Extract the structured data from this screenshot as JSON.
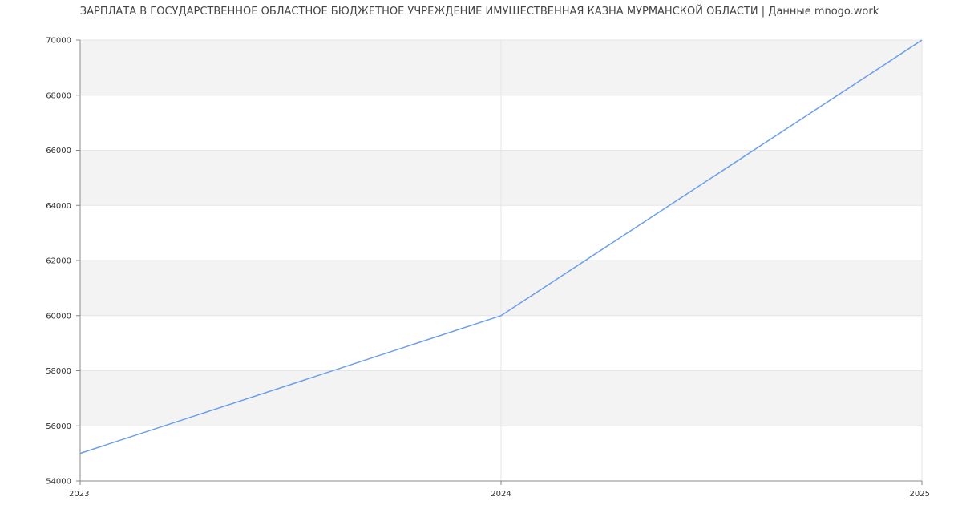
{
  "chart_data": {
    "type": "line",
    "title": "ЗАРПЛАТА В ГОСУДАРСТВЕННОЕ ОБЛАСТНОЕ БЮДЖЕТНОЕ УЧРЕЖДЕНИЕ ИМУЩЕСТВЕННАЯ КАЗНА МУРМАНСКОЙ ОБЛАСТИ | Данные mnogo.work",
    "xlabel": "",
    "ylabel": "",
    "x": [
      2023,
      2024,
      2025
    ],
    "x_tick_labels": [
      "2023",
      "2024",
      "2025"
    ],
    "series": [
      {
        "values": [
          55000,
          60000,
          70000
        ],
        "color": "#6d9eeb"
      }
    ],
    "ylim": [
      54000,
      70000
    ],
    "y_ticks": [
      54000,
      56000,
      58000,
      60000,
      62000,
      64000,
      66000,
      68000,
      70000
    ],
    "y_tick_labels": [
      "54000",
      "56000",
      "58000",
      "60000",
      "62000",
      "64000",
      "66000",
      "68000",
      "70000"
    ],
    "grid": true,
    "band_color": "#f3f3f3",
    "grid_color": "#e5e5e5",
    "axis_color": "#888888"
  }
}
